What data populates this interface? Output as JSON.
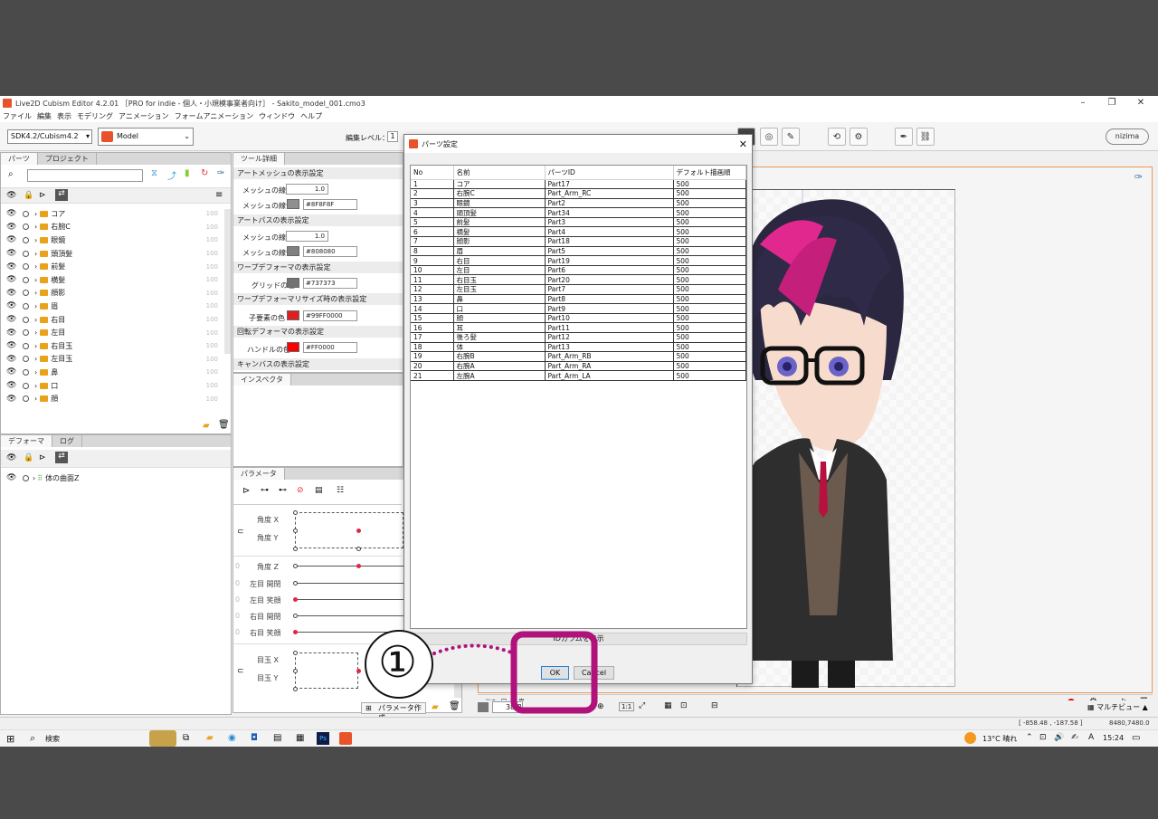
{
  "app": {
    "title": "Live2D Cubism Editor 4.2.01 ［PRO for indie - 個人・小規模事業者向け］ - Sakito_model_001.cmo3",
    "menu": [
      "ファイル",
      "編集",
      "表示",
      "モデリング",
      "アニメーション",
      "フォームアニメーション",
      "ウィンドウ",
      "ヘルプ"
    ],
    "sdk_select": "SDK4.2/Cubism4.2",
    "model_select": "Model",
    "edit_level_label": "編集レベル：",
    "edit_level_value": "1",
    "brand": "nizima"
  },
  "left_panel": {
    "tabs": [
      "パーツ",
      "プロジェクト"
    ],
    "parts": [
      {
        "name": "コア",
        "op": "100"
      },
      {
        "name": "右腕C",
        "op": "100"
      },
      {
        "name": "眼鏡",
        "op": "100"
      },
      {
        "name": "頭頂髪",
        "op": "100"
      },
      {
        "name": "前髪",
        "op": "100"
      },
      {
        "name": "横髪",
        "op": "100"
      },
      {
        "name": "顔影",
        "op": "100"
      },
      {
        "name": "眉",
        "op": "100"
      },
      {
        "name": "右目",
        "op": "100"
      },
      {
        "name": "左目",
        "op": "100"
      },
      {
        "name": "右目玉",
        "op": "100"
      },
      {
        "name": "左目玉",
        "op": "100"
      },
      {
        "name": "鼻",
        "op": "100"
      },
      {
        "name": "口",
        "op": "100"
      },
      {
        "name": "顔",
        "op": "100"
      }
    ],
    "deformer_tabs": [
      "デフォーマ",
      "ログ"
    ],
    "deformer_item": "体の曲面Z"
  },
  "tool_detail": {
    "tab": "ツール詳細",
    "sections": [
      {
        "title": "アートメッシュの表示設定",
        "rows": [
          {
            "label": "メッシュの線幅",
            "value": "1.0"
          },
          {
            "label": "メッシュの線色",
            "value": "#8F8F8F",
            "color": "#8f8f8f"
          }
        ]
      },
      {
        "title": "アートパスの表示設定",
        "rows": [
          {
            "label": "メッシュの線幅",
            "value": "1.0"
          },
          {
            "label": "メッシュの線色",
            "value": "#808080",
            "color": "#808080"
          }
        ]
      },
      {
        "title": "ワープデフォーマの表示設定",
        "rows": [
          {
            "label": "グリッドの色",
            "value": "#737373",
            "color": "#737373"
          }
        ]
      },
      {
        "title": "ワープデフォーマリサイズ時の表示設定",
        "rows": [
          {
            "label": "子要素の色",
            "value": "#99FF0000",
            "color": "#e02020"
          }
        ]
      },
      {
        "title": "回転デフォーマの表示設定",
        "rows": [
          {
            "label": "ハンドルの色",
            "value": "#FF0000",
            "color": "#ff0000"
          }
        ]
      },
      {
        "title": "キャンバスの表示設定",
        "rows": []
      }
    ],
    "inspector_tab": "インスペクタ"
  },
  "parameters": {
    "tab": "パラメータ",
    "items": [
      "角度 X",
      "角度 Y",
      "角度 Z",
      "左目 開閉",
      "左目 笑顔",
      "右目 開閉",
      "右目 笑顔",
      "目玉 X",
      "目玉 Y"
    ],
    "create_button": "パラメータ作成"
  },
  "dialog": {
    "title": "パーツ設定",
    "columns": [
      "No",
      "名前",
      "パーツID",
      "デフォルト描画順"
    ],
    "rows": [
      [
        "1",
        "コア",
        "Part17",
        "500"
      ],
      [
        "2",
        "右腕C",
        "Part_Arm_RC",
        "500"
      ],
      [
        "3",
        "眼鏡",
        "Part2",
        "500"
      ],
      [
        "4",
        "頭頂髪",
        "Part34",
        "500"
      ],
      [
        "5",
        "前髪",
        "Part3",
        "500"
      ],
      [
        "6",
        "横髪",
        "Part4",
        "500"
      ],
      [
        "7",
        "顔影",
        "Part18",
        "500"
      ],
      [
        "8",
        "眉",
        "Part5",
        "500"
      ],
      [
        "9",
        "右目",
        "Part19",
        "500"
      ],
      [
        "10",
        "左目",
        "Part6",
        "500"
      ],
      [
        "11",
        "右目玉",
        "Part20",
        "500"
      ],
      [
        "12",
        "左目玉",
        "Part7",
        "500"
      ],
      [
        "13",
        "鼻",
        "Part8",
        "500"
      ],
      [
        "14",
        "口",
        "Part9",
        "500"
      ],
      [
        "15",
        "顔",
        "Part10",
        "500"
      ],
      [
        "16",
        "耳",
        "Part11",
        "500"
      ],
      [
        "17",
        "後ろ髪",
        "Part12",
        "500"
      ],
      [
        "18",
        "体",
        "Part13",
        "500"
      ],
      [
        "19",
        "右腕B",
        "Part_Arm_RB",
        "500"
      ],
      [
        "20",
        "右腕A",
        "Part_Arm_RA",
        "500"
      ],
      [
        "21",
        "左腕A",
        "Part_Arm_LA",
        "500"
      ]
    ],
    "id_toggle": "IDカラムを表示",
    "ok": "OK",
    "cancel": "Cancel"
  },
  "canvas": {
    "zoom": "38.8",
    "ratio": "1:1",
    "coords": "[ -858.48 , -187.58 ]",
    "coords2": "8480,7480.0",
    "view_label": "マルチビュー"
  },
  "annotation": {
    "number": "①",
    "color": "#b0117a"
  },
  "taskbar": {
    "search": "検索",
    "weather": "13°C 晴れ",
    "ime": "A",
    "time": "15:24"
  }
}
